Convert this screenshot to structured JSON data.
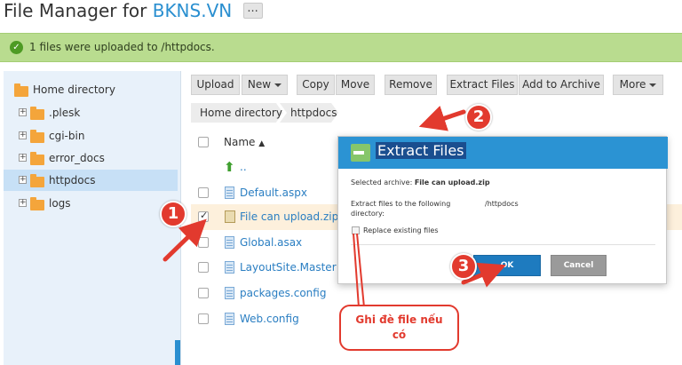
{
  "header": {
    "title": "File Manager for",
    "domain": "BKNS.VN",
    "more_label": "..."
  },
  "alert": {
    "message": "1 files were uploaded to /httpdocs."
  },
  "sidebar": {
    "items": [
      {
        "label": "Home directory"
      },
      {
        "label": ".plesk"
      },
      {
        "label": "cgi-bin"
      },
      {
        "label": "error_docs"
      },
      {
        "label": "httpdocs",
        "selected": true
      },
      {
        "label": "logs"
      }
    ],
    "expander_symbol": "+"
  },
  "toolbar": {
    "upload": "Upload",
    "new": "New",
    "copy": "Copy",
    "move": "Move",
    "remove": "Remove",
    "extract": "Extract Files",
    "add_archive": "Add to Archive",
    "more": "More"
  },
  "breadcrumb": [
    "Home directory",
    "httpdocs"
  ],
  "file_list": {
    "column_name": "Name",
    "sort_indicator": "▲",
    "parent": "..",
    "files": [
      {
        "name": "Default.aspx",
        "type": "file",
        "checked": false
      },
      {
        "name": "File can upload.zip",
        "type": "zip",
        "checked": true
      },
      {
        "name": "Global.asax",
        "type": "file",
        "checked": false
      },
      {
        "name": "LayoutSite.Master",
        "type": "file",
        "checked": false
      },
      {
        "name": "packages.config",
        "type": "file",
        "checked": false
      },
      {
        "name": "Web.config",
        "type": "file",
        "checked": false
      }
    ]
  },
  "dialog": {
    "title": "Extract Files",
    "selected_label": "Selected archive:",
    "selected_value": "File can upload.zip",
    "extract_label_line1": "Extract files to the following",
    "extract_label_line2": "directory:",
    "extract_path": "/httpdocs",
    "replace_label": "Replace existing files",
    "ok": "OK",
    "cancel": "Cancel"
  },
  "annotations": {
    "step1": "1",
    "step2": "2",
    "step3": "3",
    "callout_line1": "Ghi đè file nếu",
    "callout_line2": "có"
  },
  "colors": {
    "accent": "#2b93d3",
    "alert_bg": "#b9dc8f",
    "annotation_red": "#e23a2e",
    "folder": "#f4a53b"
  }
}
